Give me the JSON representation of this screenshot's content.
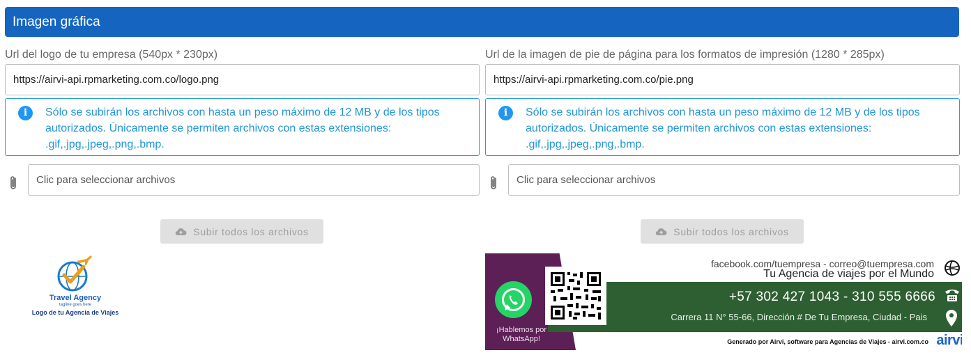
{
  "section": {
    "title": "Imagen gráfica"
  },
  "logo_field": {
    "label": "Url del logo de tu empresa (540px * 230px)",
    "url_value": "https://airvi-api.rpmarketing.com.co/logo.png",
    "info_text": "Sólo se subirán los archivos con hasta un peso máximo de 12 MB y de los tipos autorizados. Únicamente se permiten archivos con estas extensiones: .gif,.jpg,.jpeg,.png,.bmp.",
    "file_placeholder": "Clic para seleccionar archivos",
    "upload_label": "Subir todos los archivos"
  },
  "footer_field": {
    "label": "Url de la imagen de pie de página para los formatos de impresión (1280 * 285px)",
    "url_value": "https://airvi-api.rpmarketing.com.co/pie.png",
    "info_text": "Sólo se subirán los archivos con hasta un peso máximo de 12 MB y de los tipos autorizados. Únicamente se permiten archivos con estas extensiones: .gif,.jpg,.jpeg,.png,.bmp.",
    "file_placeholder": "Clic para seleccionar archivos",
    "upload_label": "Subir todos los archivos"
  },
  "logo_preview": {
    "name": "Travel Agency",
    "tagline": "tagline goes here",
    "caption": "Logo de tu Agencia de Viajes"
  },
  "footer_preview": {
    "whatsapp_text": "¡Hablemos por WhatsApp!",
    "contact": "facebook.com/tuempresa - correo@tuempresa.com",
    "slogan": "Tu Agencia de viajes por el Mundo",
    "phone": "+57 302 427 1043 - 310 555 6666",
    "address": "Carrera 11 N° 55-66, Dirección # De Tu Empresa, Ciudad - Pais",
    "generated": "Generado por Airvi, software para Agencias de Viajes - airvi.com.co",
    "brand": "airvi"
  },
  "colors": {
    "header": "#1565c0",
    "info": "#2196f3",
    "purple": "#5c1f56",
    "green": "#2e5f32",
    "whatsapp": "#25d366"
  },
  "icons": {
    "info": "info-circle-icon",
    "attach": "paperclip-icon",
    "upload": "cloud-upload-icon",
    "whatsapp": "whatsapp-icon",
    "globe": "globe-icon",
    "phone": "phone-icon",
    "location": "location-pin-icon",
    "qr": "qr-code-icon"
  }
}
